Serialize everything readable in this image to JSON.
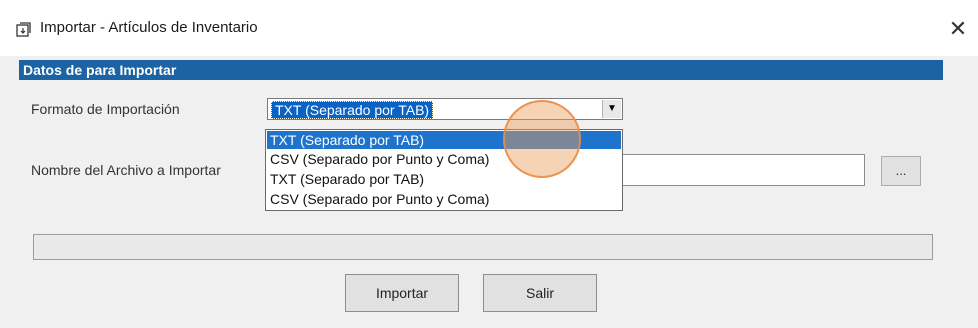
{
  "window": {
    "title": "Importar - Artículos de Inventario",
    "close_glyph": "✕"
  },
  "section": {
    "header": "Datos de para  Importar"
  },
  "format": {
    "label": "Formato de Importación",
    "selected": "TXT (Separado por TAB)",
    "options": [
      "TXT (Separado por TAB)",
      "CSV (Separado por Punto y Coma)",
      "TXT (Separado por TAB)",
      "CSV (Separado por Punto y Coma)"
    ],
    "highlighted_index": 0
  },
  "file": {
    "label": "Nombre del Archivo a Importar",
    "value": "",
    "browse_label": "..."
  },
  "progress": {
    "value_percent": 0
  },
  "buttons": {
    "import_label": "Importar",
    "exit_label": "Salir"
  },
  "colors": {
    "section_header_bg": "#1c63a3",
    "selection_bg": "#1e73cc",
    "cursor_highlight": "#ee9e5a"
  }
}
